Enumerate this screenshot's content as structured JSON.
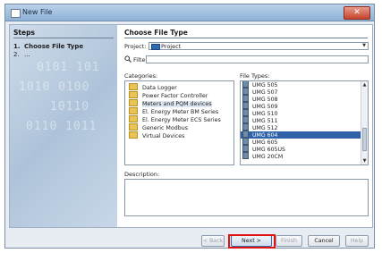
{
  "window": {
    "title": "New File",
    "close_glyph": "✕"
  },
  "steps": {
    "heading": "Steps",
    "items": [
      {
        "num": "1.",
        "label": "Choose File Type"
      },
      {
        "num": "2.",
        "label": "..."
      }
    ]
  },
  "main": {
    "heading": "Choose File Type",
    "project_label": "Project:",
    "project_value": "Project",
    "filter_label": "Filter:",
    "filter_value": "",
    "categories_label": "Categories:",
    "categories": [
      "Data Logger",
      "Power Factor Controller",
      "Meters and PQM devices",
      "El. Energy Meter BM Series",
      "El. Energy Meter ECS Series",
      "Generic Modbus",
      "Virtual Devices"
    ],
    "selected_category": "Meters and PQM devices",
    "file_types_label": "File Types:",
    "file_types": [
      "UMG 505",
      "UMG 507",
      "UMG 508",
      "UMG 509",
      "UMG 510",
      "UMG 511",
      "UMG 512",
      "UMG 604",
      "UMG 605",
      "UMG 605US",
      "UMG 20CM"
    ],
    "selected_file_type": "UMG 604",
    "description_label": "Description:",
    "description_value": ""
  },
  "buttons": {
    "back": "< Back",
    "next": "Next >",
    "finish": "Finish",
    "cancel": "Cancel",
    "help": "Help"
  },
  "colors": {
    "selection": "#2f62a8",
    "highlight_box": "#e01212",
    "folder": "#e9c455"
  },
  "icons": {
    "title_icon": "new-file-icon",
    "filter_icon": "search-icon",
    "category_icon": "folder-icon",
    "type_icon": "device-icon"
  }
}
